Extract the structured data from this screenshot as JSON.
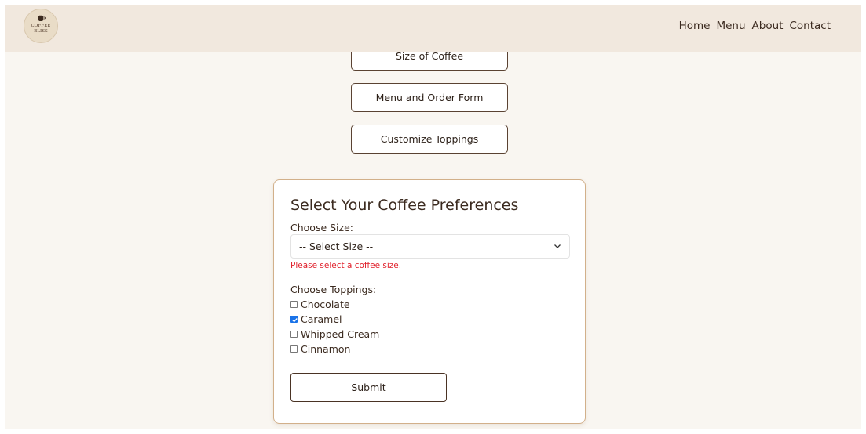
{
  "brand": {
    "logo_text_line1": "COFFEE",
    "logo_text_line2": "BLISS"
  },
  "nav": {
    "items": [
      "Home",
      "Menu",
      "About",
      "Contact"
    ]
  },
  "sections": {
    "size_button": "Size of Coffee",
    "menu_button": "Menu and Order Form",
    "toppings_button": "Customize Toppings"
  },
  "form": {
    "title": "Select Your Coffee Preferences",
    "size_label": "Choose Size:",
    "size_select_value": "-- Select Size --",
    "size_error": "Please select a coffee size.",
    "toppings_label": "Choose Toppings:",
    "toppings": [
      {
        "label": "Chocolate",
        "checked": false
      },
      {
        "label": "Caramel",
        "checked": true
      },
      {
        "label": "Whipped Cream",
        "checked": false
      },
      {
        "label": "Cinnamon",
        "checked": false
      }
    ],
    "submit_label": "Submit"
  },
  "colors": {
    "navbar_bg": "#f1e8de",
    "page_bg": "#f9f6f1",
    "error": "#e0202b",
    "checkbox_checked": "#1a73e8",
    "card_border": "#d2b08a"
  },
  "icons": {
    "dropdown": "chevron-down-icon",
    "logo": "coffee-cup-icon"
  }
}
